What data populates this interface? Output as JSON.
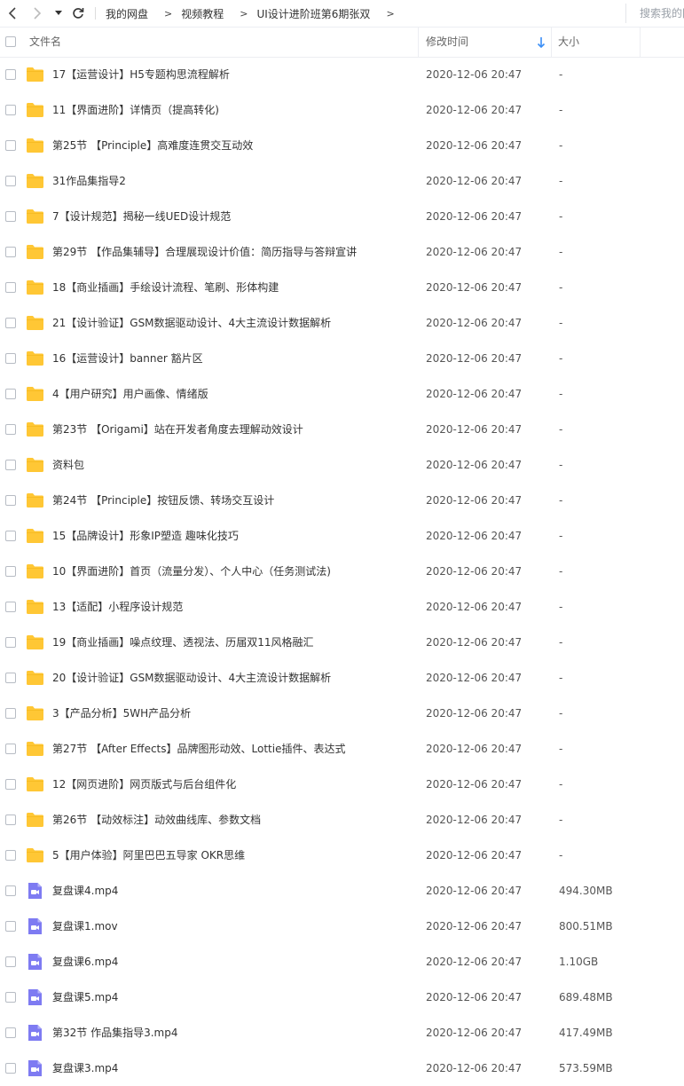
{
  "breadcrumb": [
    "我的网盘",
    "视频教程",
    "UI设计进阶班第6期张双"
  ],
  "search": {
    "placeholder": "搜索我的网盘文件"
  },
  "columns": {
    "name": "文件名",
    "time": "修改时间",
    "size": "大小"
  },
  "colors": {
    "folder": "#FFC735",
    "video": "#7E7BF2",
    "sort_arrow": "#3A8EF6"
  },
  "files": [
    {
      "type": "folder",
      "name": "17【运营设计】H5专题构思流程解析",
      "time": "2020-12-06 20:47",
      "size": "-"
    },
    {
      "type": "folder",
      "name": "11【界面进阶】详情页（提高转化)",
      "time": "2020-12-06 20:47",
      "size": "-"
    },
    {
      "type": "folder",
      "name": "第25节 【Principle】高难度连贯交互动效",
      "time": "2020-12-06 20:47",
      "size": "-"
    },
    {
      "type": "folder",
      "name": "31作品集指导2",
      "time": "2020-12-06 20:47",
      "size": "-"
    },
    {
      "type": "folder",
      "name": "7【设计规范】揭秘一线UED设计规范",
      "time": "2020-12-06 20:47",
      "size": "-"
    },
    {
      "type": "folder",
      "name": "第29节 【作品集辅导】合理展现设计价值：简历指导与答辩宣讲",
      "time": "2020-12-06 20:47",
      "size": "-"
    },
    {
      "type": "folder",
      "name": "18【商业插画】手绘设计流程、笔刷、形体构建",
      "time": "2020-12-06 20:47",
      "size": "-"
    },
    {
      "type": "folder",
      "name": "21【设计验证】GSM数据驱动设计、4大主流设计数据解析",
      "time": "2020-12-06 20:47",
      "size": "-"
    },
    {
      "type": "folder",
      "name": "16【运营设计】banner 豁片区",
      "time": "2020-12-06 20:47",
      "size": "-"
    },
    {
      "type": "folder",
      "name": "4【用户研究】用户画像、情绪版",
      "time": "2020-12-06 20:47",
      "size": "-"
    },
    {
      "type": "folder",
      "name": "第23节 【Origami】站在开发者角度去理解动效设计",
      "time": "2020-12-06 20:47",
      "size": "-"
    },
    {
      "type": "folder",
      "name": "资料包",
      "time": "2020-12-06 20:47",
      "size": "-"
    },
    {
      "type": "folder",
      "name": "第24节 【Principle】按钮反馈、转场交互设计",
      "time": "2020-12-06 20:47",
      "size": "-"
    },
    {
      "type": "folder",
      "name": "15【品牌设计】形象IP塑造  趣味化技巧",
      "time": "2020-12-06 20:47",
      "size": "-"
    },
    {
      "type": "folder",
      "name": "10【界面进阶】首页（流量分发）、个人中心（任务测试法)",
      "time": "2020-12-06 20:47",
      "size": "-"
    },
    {
      "type": "folder",
      "name": "13【适配】小程序设计规范",
      "time": "2020-12-06 20:47",
      "size": "-"
    },
    {
      "type": "folder",
      "name": "19【商业插画】噪点纹理、透视法、历届双11风格融汇",
      "time": "2020-12-06 20:47",
      "size": "-"
    },
    {
      "type": "folder",
      "name": "20【设计验证】GSM数据驱动设计、4大主流设计数据解析",
      "time": "2020-12-06 20:47",
      "size": "-"
    },
    {
      "type": "folder",
      "name": "3【产品分析】5WH产品分析",
      "time": "2020-12-06 20:47",
      "size": "-"
    },
    {
      "type": "folder",
      "name": "第27节 【After Effects】品牌图形动效、Lottie插件、表达式",
      "time": "2020-12-06 20:47",
      "size": "-"
    },
    {
      "type": "folder",
      "name": "12【网页进阶】网页版式与后台组件化",
      "time": "2020-12-06 20:47",
      "size": "-"
    },
    {
      "type": "folder",
      "name": "第26节 【动效标注】动效曲线库、参数文档",
      "time": "2020-12-06 20:47",
      "size": "-"
    },
    {
      "type": "folder",
      "name": "5【用户体验】阿里巴巴五导家 OKR思维",
      "time": "2020-12-06 20:47",
      "size": "-"
    },
    {
      "type": "video",
      "name": "复盘课4.mp4",
      "time": "2020-12-06 20:47",
      "size": "494.30MB"
    },
    {
      "type": "video",
      "name": "复盘课1.mov",
      "time": "2020-12-06 20:47",
      "size": "800.51MB"
    },
    {
      "type": "video",
      "name": "复盘课6.mp4",
      "time": "2020-12-06 20:47",
      "size": "1.10GB"
    },
    {
      "type": "video",
      "name": "复盘课5.mp4",
      "time": "2020-12-06 20:47",
      "size": "689.48MB"
    },
    {
      "type": "video",
      "name": "第32节 作品集指导3.mp4",
      "time": "2020-12-06 20:47",
      "size": "417.49MB"
    },
    {
      "type": "video",
      "name": "复盘课3.mp4",
      "time": "2020-12-06 20:47",
      "size": "573.59MB"
    }
  ]
}
